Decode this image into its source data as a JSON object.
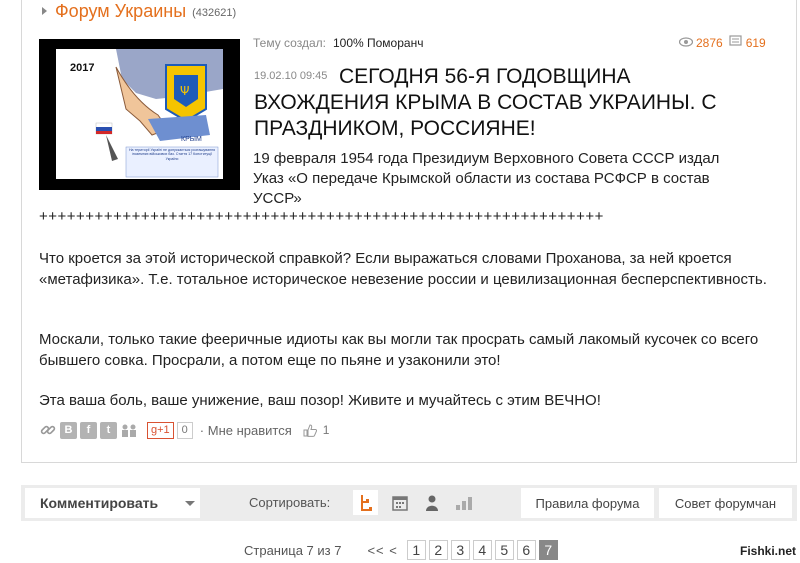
{
  "forum": {
    "title": "Форум Украины",
    "count": "(432621)"
  },
  "topic": {
    "author_label": "Тему создал:",
    "author_name": "100% Поморанч",
    "views": "2876",
    "comments": "619",
    "date": "19.02.10 09:45",
    "title": "СЕГОДНЯ 56-Я ГОДОВЩИНА ВХОЖДЕНИЯ КРЫМА В СОСТАВ УКРАИНЫ. С ПРАЗДНИКОМ, РОССИЯНЕ!",
    "lead": "19 февраля 1954 года Президиум Верховного Совета СССР издал Указ «О передаче Крымской области из состава РСФСР в состав УССР»",
    "plusline": "+++++++++++++++++++++++++++++++++++++++++++++++++++++++++++++",
    "paragraphs": [
      "Что кроется за этой исторической справкой? Если выражаться словами Проханова, за ней кроется «метафизика». Т.е. тотальное историческое невезение россии и цевилизационная бесперспективность.",
      "Москали, только такие фееричные идиоты как вы могли так просрать самый лакомый кусочек со всего бывшего совка. Просрали, а потом еще по пьяне и узаконили это!",
      "Эта ваша боль, ваше унижение, ваш позор! Живите и мучайтесь с этим ВЕЧНО!"
    ],
    "image": {
      "year": "2017",
      "region": "КРЫМ",
      "caption": "На території Україні не допускається розташування іноземних військових баз. Стаття 17 Конституції України"
    }
  },
  "share": {
    "vk": "B",
    "fb": "f",
    "tw": "t",
    "gplus": "g+1",
    "gplus_count": "0",
    "like_label": "· Мне нравится",
    "like_count": "1"
  },
  "toolbar": {
    "comment_label": "Комментировать",
    "sort_label": "Сортировать:",
    "rules_label": "Правила форума",
    "advice_label": "Совет форумчан"
  },
  "pager": {
    "label": "Страница 7 из 7",
    "nav": "<< <",
    "pages": [
      "1",
      "2",
      "3",
      "4",
      "5",
      "6",
      "7"
    ],
    "current": "7"
  },
  "watermark": "Fishki.net",
  "colors": {
    "accent": "#e4701e",
    "toolbar_bg": "#ececec",
    "current_page": "#888888"
  }
}
